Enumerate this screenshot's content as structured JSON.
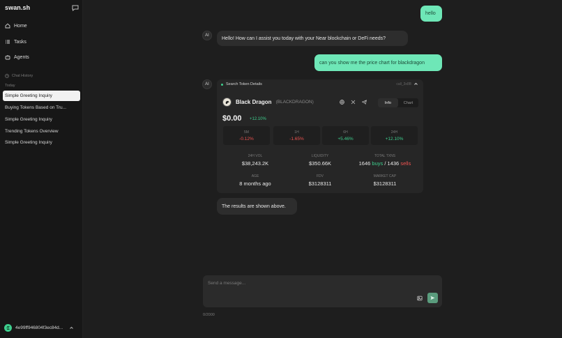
{
  "sidebar": {
    "brand": "swan.sh",
    "nav": [
      {
        "label": "Home",
        "icon": "home-icon"
      },
      {
        "label": "Tasks",
        "icon": "tasks-icon"
      },
      {
        "label": "Agents",
        "icon": "agents-icon"
      }
    ],
    "history_title": "Chat History",
    "today_label": "Today",
    "history": [
      "Simple Greeting Inquiry",
      "Buying Tokens Based on Tru...",
      "Simple Greeting Inquiry",
      "Trending Tokens Overview",
      "Simple Greeting Inquiry"
    ],
    "wallet": "4e99ff946804f3ec84d..."
  },
  "chat": {
    "user_1": "hello",
    "ai_label": "AI",
    "ai_1": "Hello! How can I assist you today with your Near blockchain or DeFi needs?",
    "user_2": "can you show me the price chart for blackdragon",
    "ai_final": "The results are shown above."
  },
  "tool": {
    "title": "Search Token Details",
    "id": "call_3x8B",
    "token_name": "Black Dragon",
    "token_symbol": "(BLACKDRAGON)",
    "tabs": [
      "Info",
      "Chart"
    ],
    "price": "$0.00",
    "price_change": "+12.10%",
    "periods": [
      {
        "label": "5M",
        "value": "-0.12%"
      },
      {
        "label": "1H",
        "value": "-1.65%"
      },
      {
        "label": "6H",
        "value": "+5.46%"
      },
      {
        "label": "24H",
        "value": "+12.10%"
      }
    ],
    "metrics": {
      "vol_label": "24H VOL",
      "vol": "$38,243.2K",
      "liq_label": "LIQUIDITY",
      "liq": "$350.66K",
      "txns_label": "TOTAL TXNS",
      "buys_n": "1646",
      "buys": "buys",
      "slash": "/",
      "sells_n": "1436",
      "sells": "sells",
      "age_label": "AGE",
      "age": "8 months ago",
      "fdv_label": "FDV",
      "fdv": "$3128311",
      "mcap_label": "MARKET CAP",
      "mcap": "$3128311"
    }
  },
  "composer": {
    "placeholder": "Send a message...",
    "counter": "0/2000"
  },
  "colors": {
    "accent": "#6ee7b7",
    "positive": "#3ecf8e",
    "negative": "#ef5350"
  }
}
